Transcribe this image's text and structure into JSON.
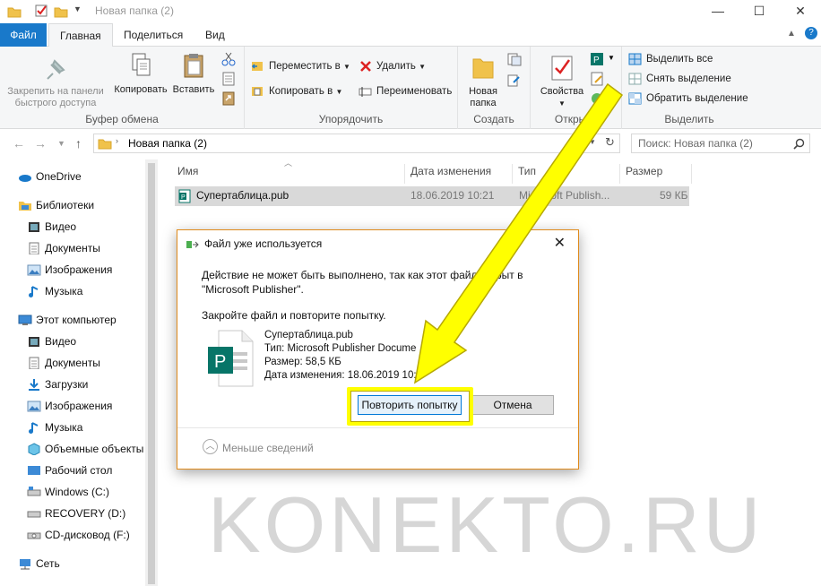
{
  "window": {
    "title": "Новая папка (2)",
    "controls": {
      "minimize": "—",
      "maximize": "☐",
      "close": "✕"
    }
  },
  "tabs": [
    {
      "label": "Файл"
    },
    {
      "label": "Главная"
    },
    {
      "label": "Поделиться"
    },
    {
      "label": "Вид"
    }
  ],
  "ribbon": {
    "clipboard": {
      "pin_line1": "Закрепить на панели",
      "pin_line2": "быстрого доступа",
      "copy": "Копировать",
      "paste": "Вставить",
      "label": "Буфер обмена"
    },
    "organize": {
      "move": "Переместить в",
      "copy_to": "Копировать в",
      "delete": "Удалить",
      "rename": "Переименовать",
      "label": "Упорядочить"
    },
    "new": {
      "line1": "Новая",
      "line2": "папка",
      "label": "Создать"
    },
    "open": {
      "properties": "Свойства",
      "label": "Открыть"
    },
    "select": {
      "all": "Выделить все",
      "none": "Снять выделение",
      "invert": "Обратить выделение",
      "label": "Выделить"
    }
  },
  "address": {
    "path": "Новая папка (2)",
    "search_placeholder": "Поиск: Новая папка (2)"
  },
  "nav": {
    "items": [
      {
        "label": "OneDrive"
      },
      {
        "label": "Библиотеки"
      },
      {
        "label": "Видео"
      },
      {
        "label": "Документы"
      },
      {
        "label": "Изображения"
      },
      {
        "label": "Музыка"
      },
      {
        "label": "Этот компьютер"
      },
      {
        "label": "Видео"
      },
      {
        "label": "Документы"
      },
      {
        "label": "Загрузки"
      },
      {
        "label": "Изображения"
      },
      {
        "label": "Музыка"
      },
      {
        "label": "Объемные объекты"
      },
      {
        "label": "Рабочий стол"
      },
      {
        "label": "Windows (C:)"
      },
      {
        "label": "RECOVERY (D:)"
      },
      {
        "label": "CD-дисковод (F:)"
      },
      {
        "label": "Сеть"
      }
    ]
  },
  "columns": {
    "name": "Имя",
    "date": "Дата изменения",
    "type": "Тип",
    "size": "Размер"
  },
  "file": {
    "name": "Супертаблица.pub",
    "date": "18.06.2019 10:21",
    "type": "Microsoft Publish...",
    "size": "59 КБ"
  },
  "dialog": {
    "title": "Файл уже используется",
    "message_line1": "Действие не может быть выполнено, так как этот файл открыт в",
    "message_line2": "\"Microsoft Publisher\".",
    "message2": "Закройте файл и повторите попытку.",
    "file_name": "Супертаблица.pub",
    "file_type": "Тип: Microsoft Publisher Docume",
    "file_size": "Размер: 58,5 КБ",
    "file_date": "Дата изменения: 18.06.2019 10:2",
    "retry": "Повторить попытку",
    "cancel": "Отмена",
    "less": "Меньше сведений"
  },
  "watermark": "KONEKTO.RU",
  "colors": {
    "accent": "#1979ca",
    "highlight": "#ffff00",
    "dialog_border": "#e08b1c",
    "publisher": "#077568"
  }
}
